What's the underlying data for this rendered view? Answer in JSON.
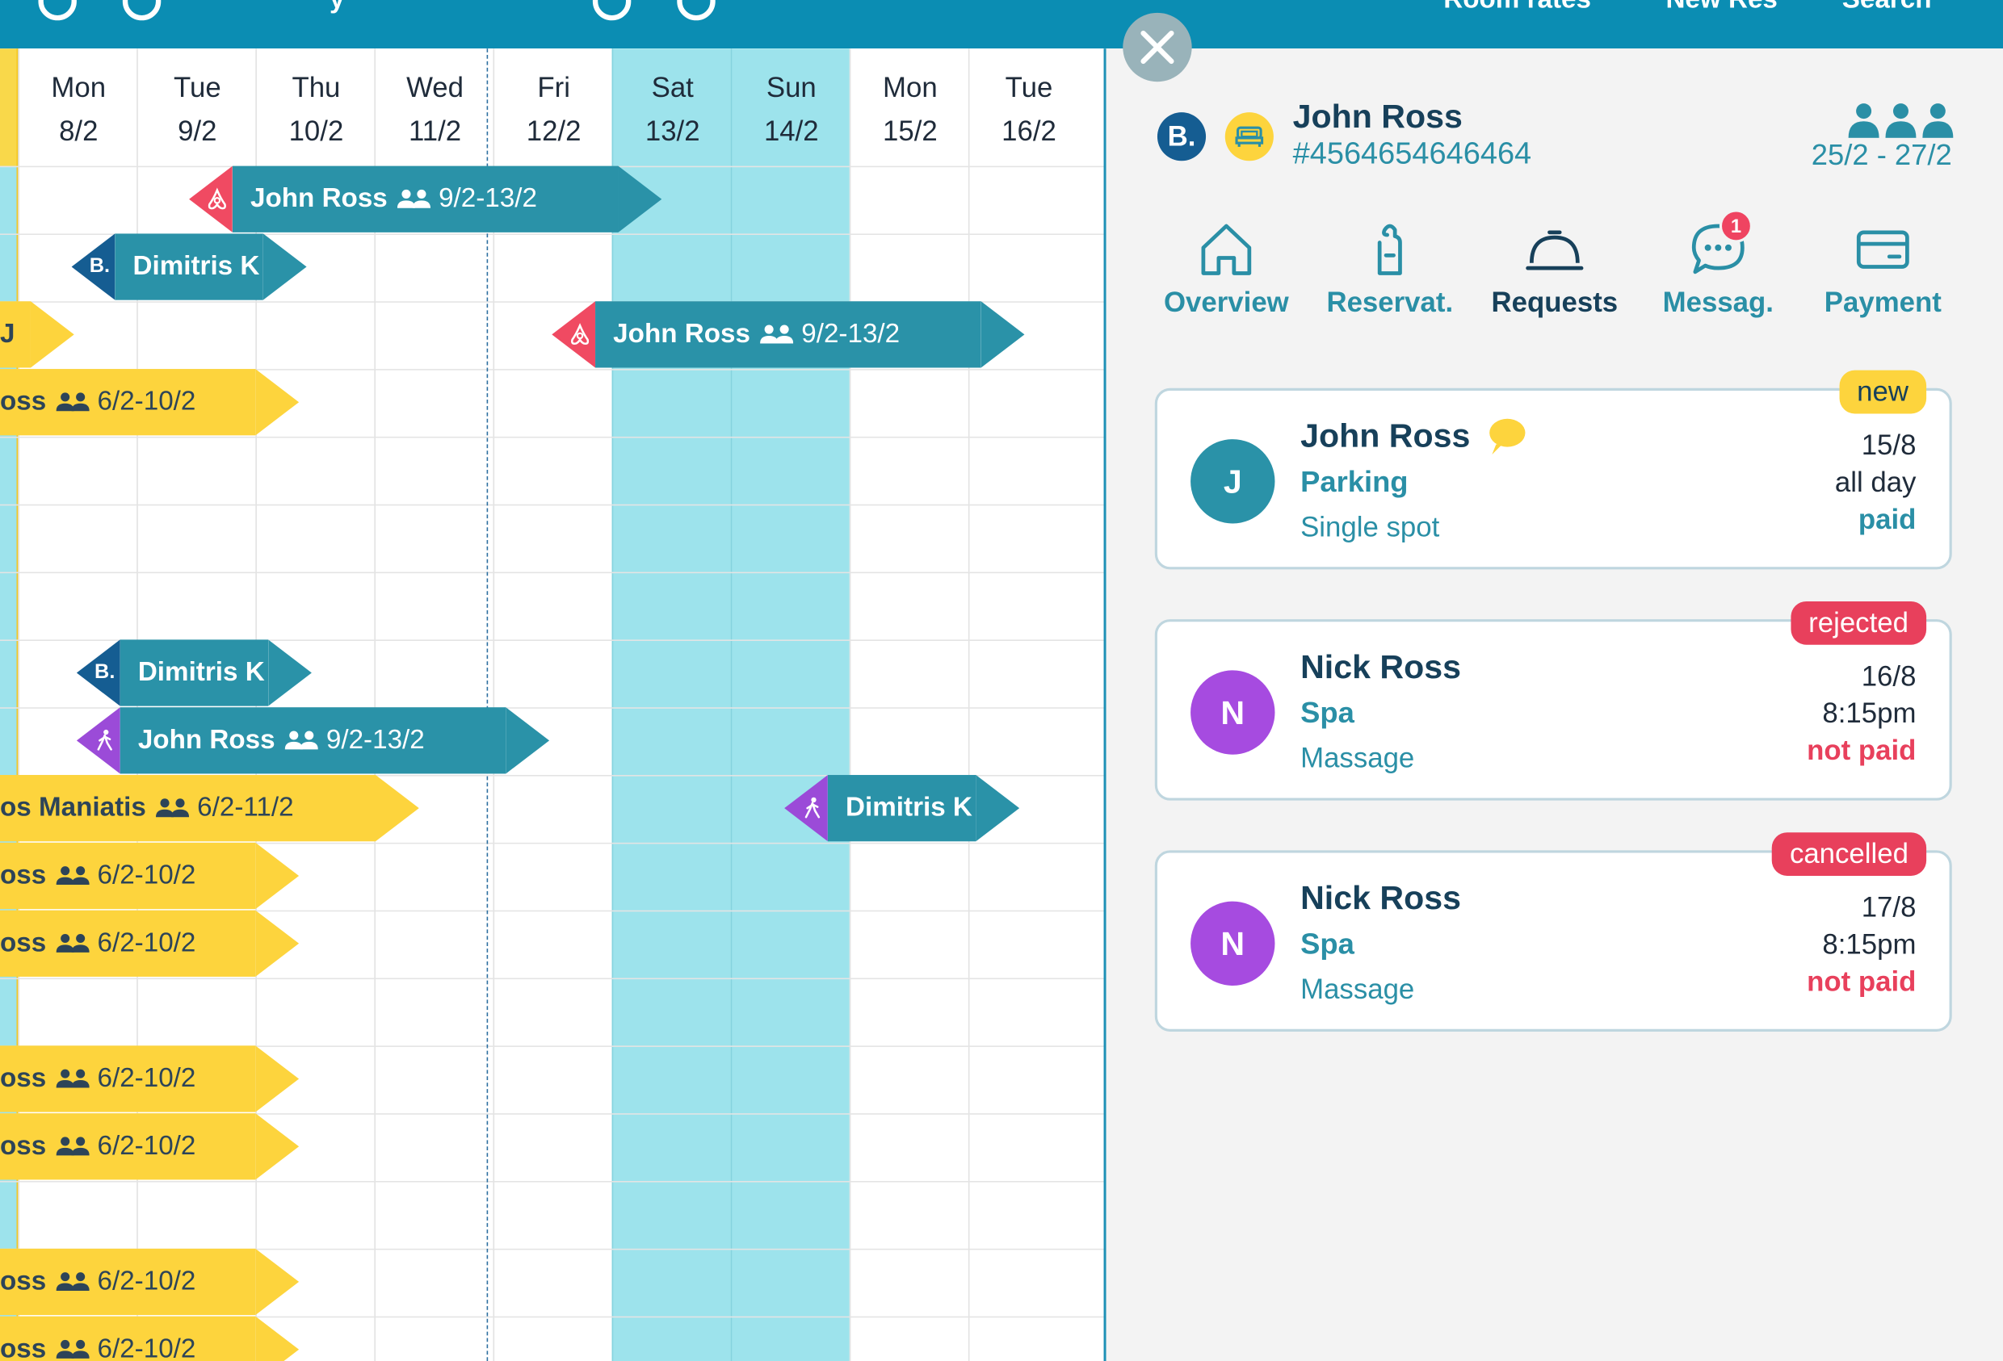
{
  "topbar": {
    "title_partial": "y",
    "links": [
      "Room rates",
      "New Res",
      "Search"
    ]
  },
  "calendar": {
    "days": [
      {
        "dow": "Mon",
        "date": "8/2"
      },
      {
        "dow": "Tue",
        "date": "9/2"
      },
      {
        "dow": "Thu",
        "date": "10/2"
      },
      {
        "dow": "Wed",
        "date": "11/2"
      },
      {
        "dow": "Fri",
        "date": "12/2"
      },
      {
        "dow": "Sat",
        "date": "13/2"
      },
      {
        "dow": "Sun",
        "date": "14/2"
      },
      {
        "dow": "Mon",
        "date": "15/2"
      },
      {
        "dow": "Tue",
        "date": "16/2"
      }
    ],
    "bookings": [
      {
        "name": "John Ross",
        "dates": "9/2-13/2",
        "source": "airbnb",
        "source_icon": "airbnb-icon",
        "color": "teal",
        "people": true
      },
      {
        "name": "Dimitris K",
        "dates": "",
        "source": "booking",
        "source_icon": "booking-icon",
        "source_label": "B.",
        "color": "teal",
        "people": false
      },
      {
        "name": "J",
        "dates": "",
        "source": "",
        "color": "yellow",
        "people": false
      },
      {
        "name": "John Ross",
        "dates": "9/2-13/2",
        "source": "airbnb",
        "source_icon": "airbnb-icon",
        "color": "teal",
        "people": true
      },
      {
        "name": "oss",
        "dates": "6/2-10/2",
        "source": "",
        "color": "yellow",
        "people": true
      },
      {
        "name": "Dimitris K",
        "dates": "",
        "source": "booking",
        "source_icon": "booking-icon",
        "source_label": "B.",
        "color": "teal",
        "people": false
      },
      {
        "name": "John Ross",
        "dates": "9/2-13/2",
        "source": "walkin",
        "source_icon": "walk-in-icon",
        "color": "teal",
        "people": true
      },
      {
        "name": "os Maniatis",
        "dates": "6/2-11/2",
        "source": "",
        "color": "yellow",
        "people": true
      },
      {
        "name": "Dimitris K",
        "dates": "",
        "source": "walkin",
        "source_icon": "walk-in-icon",
        "color": "teal",
        "people": false
      },
      {
        "name": "oss",
        "dates": "6/2-10/2",
        "source": "",
        "color": "yellow",
        "people": true
      },
      {
        "name": "oss",
        "dates": "6/2-10/2",
        "source": "",
        "color": "yellow",
        "people": true
      },
      {
        "name": "oss",
        "dates": "6/2-10/2",
        "source": "",
        "color": "yellow",
        "people": true
      },
      {
        "name": "oss",
        "dates": "6/2-10/2",
        "source": "",
        "color": "yellow",
        "people": true
      },
      {
        "name": "oss",
        "dates": "6/2-10/2",
        "source": "",
        "color": "yellow",
        "people": true
      },
      {
        "name": "oss",
        "dates": "6/2-10/2",
        "source": "",
        "color": "yellow",
        "people": true
      }
    ]
  },
  "panel": {
    "close_icon": "close-icon",
    "source_badge": "B.",
    "guest_name": "John Ross",
    "reservation_id": "#4564654646464",
    "stay_dates": "25/2 - 27/2",
    "tabs": [
      {
        "label": "Overview",
        "icon": "home-icon"
      },
      {
        "label": "Reservat.",
        "icon": "door-hanger-icon"
      },
      {
        "label": "Requests",
        "icon": "service-bell-icon",
        "active": true
      },
      {
        "label": "Messag.",
        "icon": "chat-icon",
        "badge": "1"
      },
      {
        "label": "Payment",
        "icon": "credit-card-icon"
      }
    ],
    "requests": [
      {
        "initial": "J",
        "name": "John Ross",
        "type": "Parking",
        "detail": "Single spot",
        "date": "15/8",
        "time": "all day",
        "payment": "paid",
        "tag": "new",
        "avatar_color": "#2a92a8"
      },
      {
        "initial": "N",
        "name": "Nick Ross",
        "type": "Spa",
        "detail": "Massage",
        "date": "16/8",
        "time": "8:15pm",
        "payment": "not paid",
        "tag": "rejected",
        "avatar_color": "#a64be0"
      },
      {
        "initial": "N",
        "name": "Nick Ross",
        "type": "Spa",
        "detail": "Massage",
        "date": "17/8",
        "time": "8:15pm",
        "payment": "not paid",
        "tag": "cancelled",
        "avatar_color": "#a64be0"
      }
    ]
  },
  "colors": {
    "brand": "#0b8db3",
    "teal_bar": "#2a92a8",
    "yellow_bar": "#fdd43d",
    "weekend": "#9de3ec",
    "alert": "#e8405c"
  }
}
